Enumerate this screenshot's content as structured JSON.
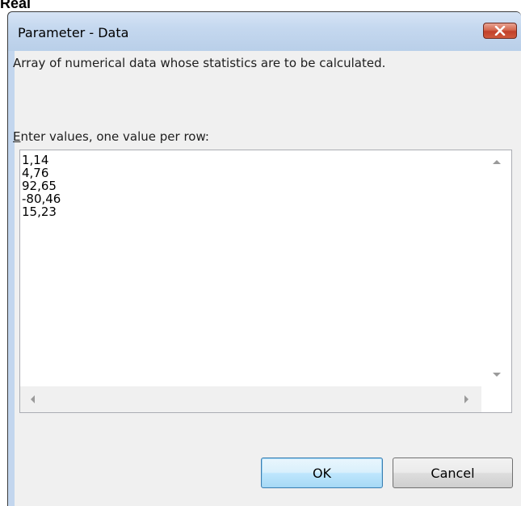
{
  "background": {
    "partial_text": "Real"
  },
  "dialog": {
    "title": "Parameter - Data",
    "close_icon": "close-icon",
    "description": "Array of numerical data whose statistics are to be calculated.",
    "prompt_accel": "E",
    "prompt_rest": "nter values, one value per row:",
    "values": [
      "1,14",
      "4,76",
      "92,65",
      "-80,46",
      "15,23"
    ],
    "ok_label": "OK",
    "cancel_label": "Cancel"
  },
  "colors": {
    "close_button": "#c2402a",
    "client_bg": "#f0f0f0",
    "ok_border": "#3c7fb1"
  }
}
